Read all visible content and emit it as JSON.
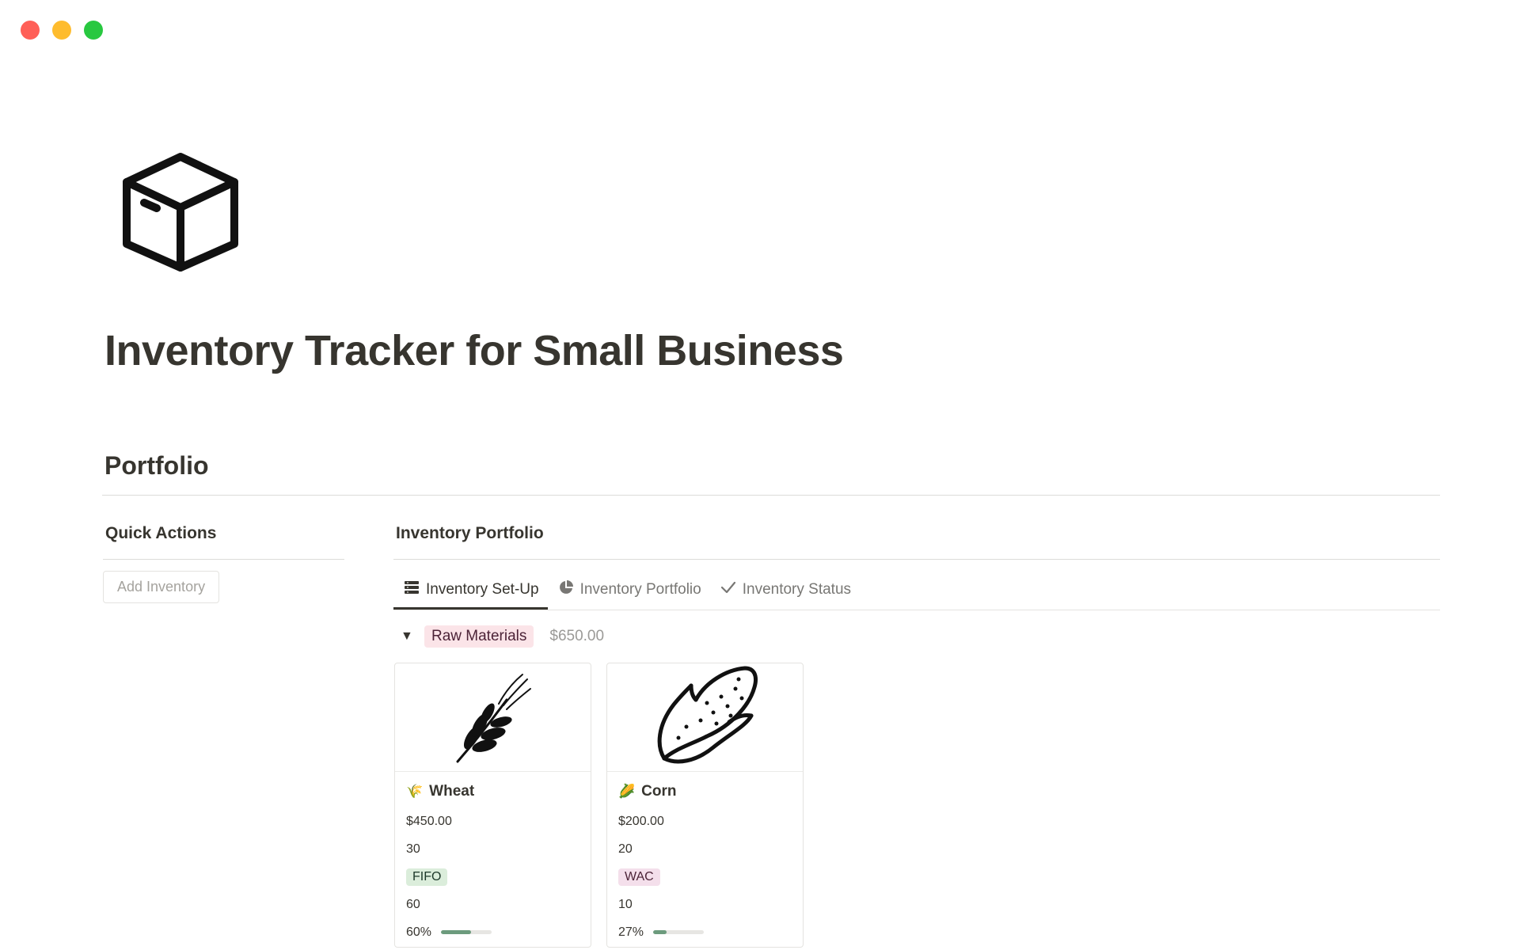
{
  "window": {
    "controls": [
      "close",
      "minimize",
      "maximize"
    ],
    "colors": {
      "close": "#ff5f57",
      "minimize": "#febc2e",
      "maximize": "#28c840"
    }
  },
  "page": {
    "icon": "box-icon",
    "title": "Inventory Tracker for Small Business"
  },
  "section": {
    "heading": "Portfolio"
  },
  "quick_actions": {
    "heading": "Quick Actions",
    "add_button_label": "Add Inventory"
  },
  "portfolio": {
    "heading": "Inventory Portfolio",
    "tabs": [
      {
        "label": "Inventory Set-Up",
        "icon": "table-icon",
        "active": true
      },
      {
        "label": "Inventory Portfolio",
        "icon": "pie-chart-icon",
        "active": false
      },
      {
        "label": "Inventory Status",
        "icon": "checkmark-icon",
        "active": false
      }
    ],
    "group": {
      "toggle": "▼",
      "label": "Raw Materials",
      "total": "$650.00"
    },
    "cards": [
      {
        "cover_icon": "wheat-icon",
        "emoji": "🌾",
        "name": "Wheat",
        "value": "$450.00",
        "quantity": "30",
        "method": "FIFO",
        "stock": "60",
        "percent_label": "60%",
        "percent": 0.6
      },
      {
        "cover_icon": "corn-icon",
        "emoji": "🌽",
        "name": "Corn",
        "value": "$200.00",
        "quantity": "20",
        "method": "WAC",
        "stock": "10",
        "percent_label": "27%",
        "percent": 0.27
      }
    ]
  },
  "colors": {
    "text": "#37352f",
    "muted": "#787774",
    "raw_materials_tag": "#fbe4e8",
    "fifo_tag": "#dbeddb",
    "wac_tag": "#f4dfeb",
    "progress": "#6c9b7d"
  }
}
